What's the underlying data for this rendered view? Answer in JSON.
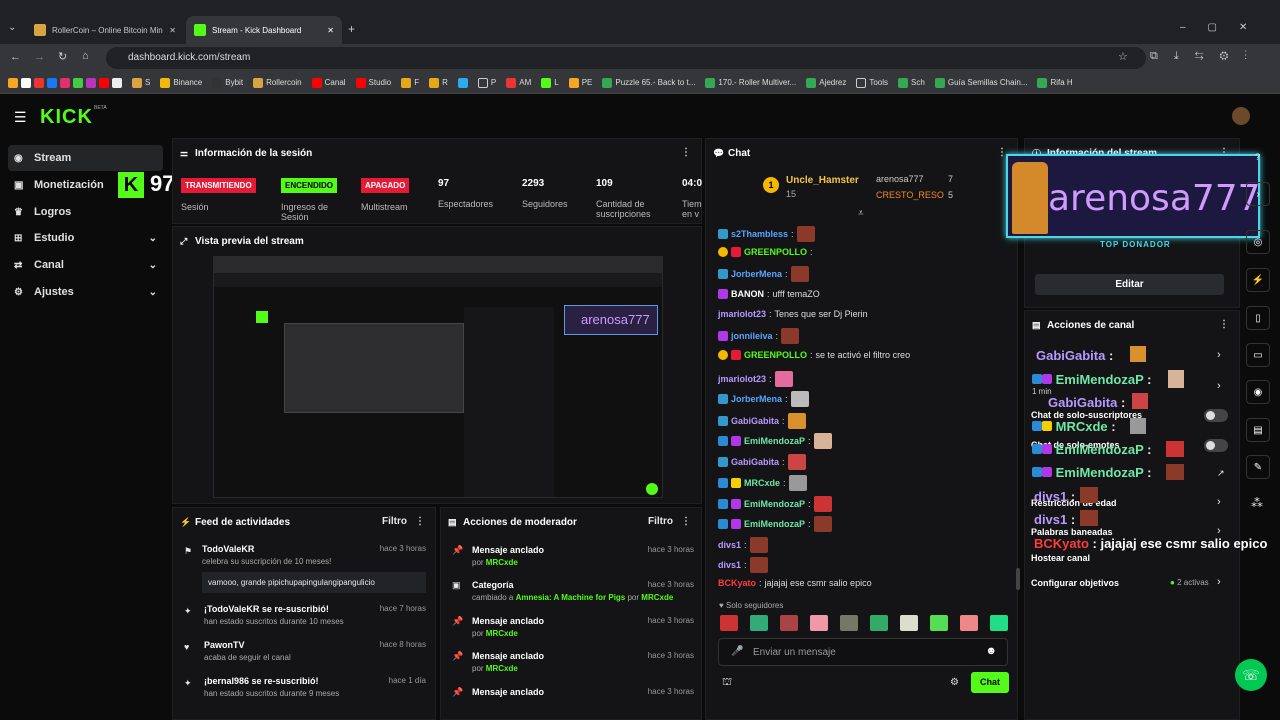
{
  "browser": {
    "tabs": [
      {
        "title": "RollerCoin – Online Bitcoin Min"
      },
      {
        "title": "Stream - Kick Dashboard"
      }
    ],
    "new_tab": "+",
    "url": "dashboard.kick.com/stream",
    "bookmarks": [
      "S",
      "Binance",
      "Bybit",
      "Rollercoin",
      "Canal",
      "Studio",
      "F",
      "R",
      "P",
      "AM",
      "L",
      "PE",
      "Puzzle 65.- Back to t...",
      "170.- Roller Multiver...",
      "Ajedrez",
      "Tools",
      "Sch",
      "Guía Semillas Chain...",
      "Rifa H"
    ]
  },
  "kick": {
    "logo": "KICK",
    "beta": "BETA",
    "stream_counter": "97"
  },
  "sidebar": {
    "items": [
      {
        "label": "Stream",
        "icon": "stream-icon"
      },
      {
        "label": "Monetización",
        "icon": "money-icon"
      },
      {
        "label": "Logros",
        "icon": "trophy-icon"
      },
      {
        "label": "Estudio",
        "icon": "studio-icon"
      },
      {
        "label": "Canal",
        "icon": "channel-icon"
      },
      {
        "label": "Ajustes",
        "icon": "gear-icon"
      }
    ]
  },
  "session": {
    "title": "Información de la sesión",
    "stats": [
      {
        "badge": "TRANSMITIENDO",
        "label": "Sesión"
      },
      {
        "badge": "ENCENDIDO",
        "label": "Ingresos de Sesión"
      },
      {
        "badge": "APAGADO",
        "label": "Multistream"
      },
      {
        "value": "97",
        "label": "Espectadores"
      },
      {
        "value": "2293",
        "label": "Seguidores"
      },
      {
        "value": "109",
        "label": "Cantidad de suscripciones"
      },
      {
        "value": "04:0",
        "label": "Tiem en v"
      }
    ]
  },
  "preview": {
    "title": "Vista previa del stream",
    "overlay_name": "arenosa777"
  },
  "feed": {
    "title": "Feed de actividades",
    "filter": "Filtro",
    "items": [
      {
        "name": "TodoValeKR",
        "desc": "celebra su suscripción de 10 meses!",
        "time": "hace 3 horas",
        "message": "vamooo, grande pipichupapingulangipangulicio"
      },
      {
        "name": "¡TodoValeKR se re-suscribió!",
        "desc": "han estado suscritos durante 10 meses",
        "time": "hace 7 horas"
      },
      {
        "name": "PawonTV",
        "desc": "acaba de seguir el canal",
        "time": "hace 8 horas"
      },
      {
        "name": "¡bernal986 se re-suscribió!",
        "desc": "han estado suscritos durante 9 meses",
        "time": "hace 1 día"
      }
    ]
  },
  "mod": {
    "title": "Acciones de moderador",
    "filter": "Filtro",
    "items": [
      {
        "title": "Mensaje anclado",
        "by": "por",
        "user": "MRCxde",
        "time": "hace 3 horas"
      },
      {
        "title": "Categoría",
        "by": "cambiado a",
        "cat": "Amnesia: A Machine for Pigs",
        "por": "por",
        "user": "MRCxde",
        "time": "hace 3 horas"
      },
      {
        "title": "Mensaje anclado",
        "by": "por",
        "user": "MRCxde",
        "time": "hace 3 horas"
      },
      {
        "title": "Mensaje anclado",
        "by": "por",
        "user": "MRCxde",
        "time": "hace 3 horas"
      },
      {
        "title": "Mensaje anclado",
        "time": "hace 3 horas"
      }
    ]
  },
  "chat": {
    "title": "Chat",
    "top": [
      {
        "name": "Uncle_Hamster",
        "count": "15"
      },
      {
        "name": "arenosa777",
        "count": "7"
      },
      {
        "name": "CRESTO_RESO",
        "count": "5"
      }
    ],
    "messages": [
      {
        "user": "s2Thambless",
        "text": ""
      },
      {
        "user": "GREENPOLLO",
        "text": ""
      },
      {
        "user": "JorberMena",
        "text": ""
      },
      {
        "user": "BANON",
        "text": "ufff temaZO"
      },
      {
        "user": "jmariolot23",
        "text": "Tenes que ser Dj Pierin"
      },
      {
        "user": "jonnileiva",
        "text": ""
      },
      {
        "user": "GREENPOLLO",
        "text": "se te activó el filtro creo"
      },
      {
        "user": "jmariolot23",
        "text": ""
      },
      {
        "user": "JorberMena",
        "text": ""
      },
      {
        "user": "GabiGabita",
        "text": ""
      },
      {
        "user": "EmiMendozaP",
        "text": ""
      },
      {
        "user": "GabiGabita",
        "text": ""
      },
      {
        "user": "MRCxde",
        "text": ""
      },
      {
        "user": "EmiMendozaP",
        "text": ""
      },
      {
        "user": "EmiMendozaP",
        "text": ""
      },
      {
        "user": "divs1",
        "text": ""
      },
      {
        "user": "divs1",
        "text": ""
      },
      {
        "user": "BCKyato",
        "text": "jajajaj ese csmr salio epico"
      }
    ],
    "followers_only": "Solo seguidores",
    "input_placeholder": "Enviar un mensaje",
    "send": "Chat"
  },
  "stream_info": {
    "title": "Información del stream",
    "top_donor": "TOP DONADOR",
    "donor_name": "arenosa777",
    "edit": "Editar"
  },
  "channel_actions": {
    "title": "Acciones de canal",
    "rows": [
      "Chat de solo-suscriptores",
      "Chat de solo-emotes",
      "Restricción de edad",
      "Palabras baneadas",
      "Hostear canal",
      "Configurar objetivos"
    ],
    "objectives_active": "2 activas",
    "time_label": "1 min"
  },
  "overlay_chat": [
    {
      "user": "GabiGabita",
      "color": "#b79aff"
    },
    {
      "user": "EmiMendozaP",
      "color": "#6ee7a8"
    },
    {
      "user": "GabiGabita",
      "color": "#b79aff"
    },
    {
      "user": "MRCxde",
      "color": "#6ee7a8"
    },
    {
      "user": "EmiMendozaP",
      "color": "#6ee7a8"
    },
    {
      "user": "EmiMendozaP",
      "color": "#6ee7a8"
    },
    {
      "user": "divs1",
      "color": "#b79aff"
    },
    {
      "user": "divs1",
      "color": "#b79aff"
    },
    {
      "user": "BCKyato",
      "color": "#ff3b3b",
      "text": "jajajaj ese csmr salio epico"
    }
  ],
  "colors": {
    "kick_green": "#53fc18",
    "live_red": "#e41a36",
    "bg": "#0b0b0c",
    "panel": "#141416"
  }
}
